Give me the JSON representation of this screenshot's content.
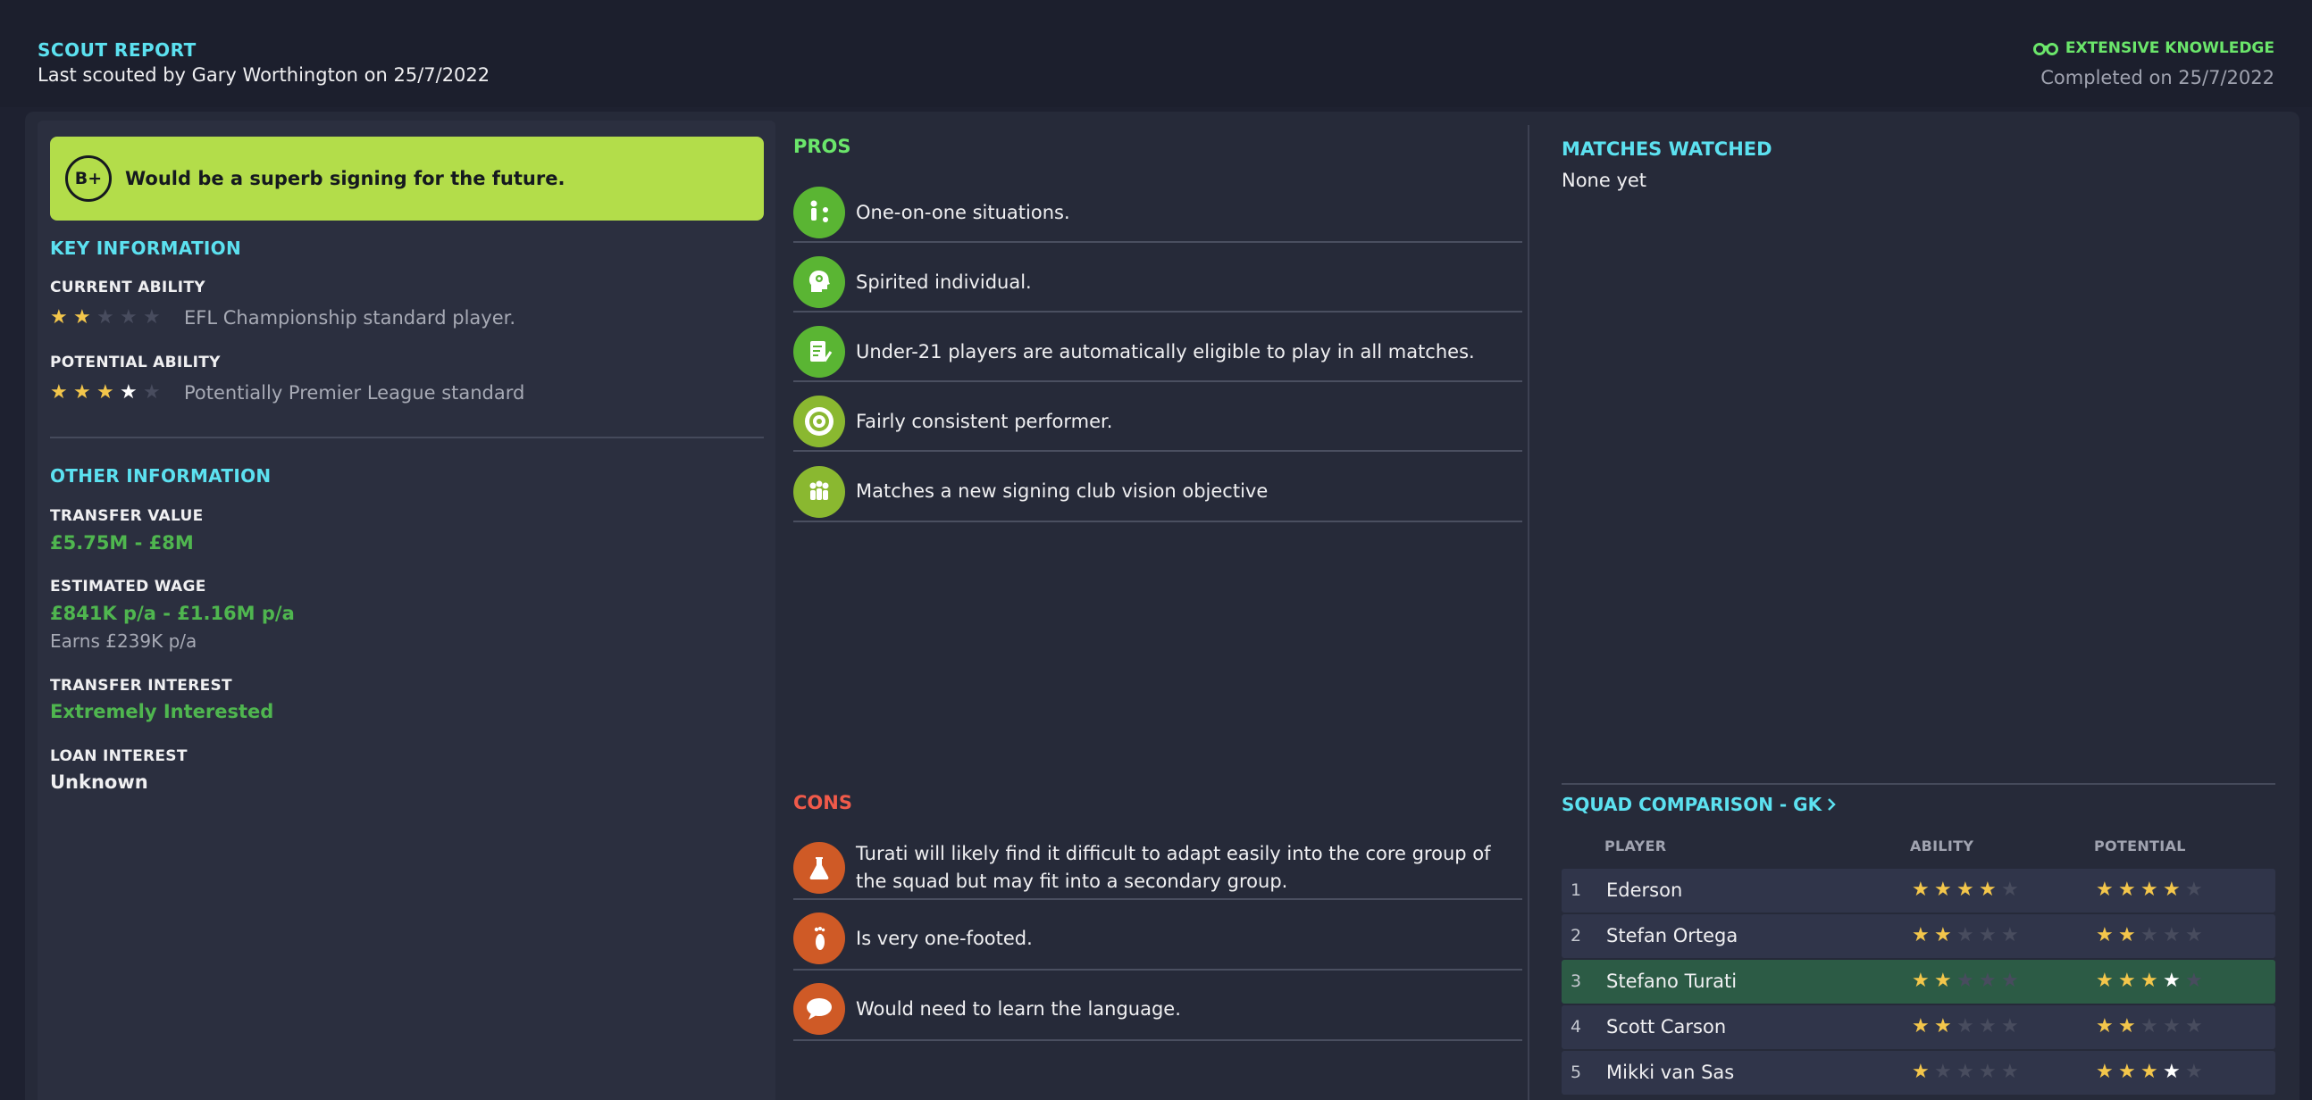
{
  "header": {
    "title": "SCOUT REPORT",
    "subtitle": "Last scouted by Gary Worthington on 25/7/2022",
    "knowledge": "EXTENSIVE KNOWLEDGE",
    "knowledge_icon": "binoculars-icon",
    "completed": "Completed on 25/7/2022"
  },
  "verdict": {
    "grade": "B+",
    "text": "Would be a superb signing for the future.",
    "color": "#b3dd4a"
  },
  "key_information": {
    "title": "KEY INFORMATION",
    "current_ability": {
      "label": "CURRENT ABILITY",
      "stars": 2,
      "text": "EFL Championship standard player."
    },
    "potential_ability": {
      "label": "POTENTIAL ABILITY",
      "stars": 3.5,
      "text": "Potentially Premier League standard"
    }
  },
  "other_information": {
    "title": "OTHER INFORMATION",
    "transfer_value": {
      "label": "TRANSFER VALUE",
      "value": "£5.75M - £8M"
    },
    "estimated_wage": {
      "label": "ESTIMATED WAGE",
      "value": "£841K p/a - £1.16M p/a",
      "note": "Earns £239K p/a"
    },
    "transfer_interest": {
      "label": "TRANSFER INTEREST",
      "value": "Extremely Interested"
    },
    "loan_interest": {
      "label": "LOAN INTEREST",
      "value": "Unknown"
    }
  },
  "pros": {
    "title": "PROS",
    "items": [
      {
        "text": "One-on-one situations.",
        "icon": "one-on-one-icon"
      },
      {
        "text": "Spirited individual.",
        "icon": "head-icon"
      },
      {
        "text": "Under-21 players are automatically eligible to play in all matches.",
        "icon": "registration-icon"
      },
      {
        "text": "Fairly consistent performer.",
        "icon": "target-icon"
      },
      {
        "text": "Matches a new signing club vision objective",
        "icon": "group-icon"
      }
    ]
  },
  "cons": {
    "title": "CONS",
    "items": [
      {
        "text": "Turati will likely find it difficult to adapt easily into the core group of the squad but may fit into a secondary group.",
        "icon": "flask-icon"
      },
      {
        "text": "Is very one-footed.",
        "icon": "foot-icon"
      },
      {
        "text": "Would need to learn the language.",
        "icon": "speech-bubble-icon"
      }
    ]
  },
  "matches_watched": {
    "title": "MATCHES WATCHED",
    "text": "None yet"
  },
  "squad_comparison": {
    "title": "SQUAD COMPARISON - GK",
    "columns": [
      "PLAYER",
      "ABILITY",
      "POTENTIAL"
    ],
    "rows": [
      {
        "rank": "1",
        "name": "Ederson",
        "ability": 4,
        "potential": 4,
        "highlighted": false
      },
      {
        "rank": "2",
        "name": "Stefan Ortega",
        "ability": 2,
        "potential": 2,
        "highlighted": false
      },
      {
        "rank": "3",
        "name": "Stefano Turati",
        "ability": 2,
        "potential": 3.5,
        "highlighted": true
      },
      {
        "rank": "4",
        "name": "Scott Carson",
        "ability": 2,
        "potential": 2,
        "highlighted": false
      },
      {
        "rank": "5",
        "name": "Mikki van Sas",
        "ability": 1,
        "potential": 3.5,
        "highlighted": false
      }
    ]
  },
  "colors": {
    "accent_cyan": "#5ce1f0",
    "pros_green": "#6be66b",
    "cons_red": "#f05a4a",
    "value_green": "#4fb64f",
    "star_gold": "#f3c64b"
  }
}
